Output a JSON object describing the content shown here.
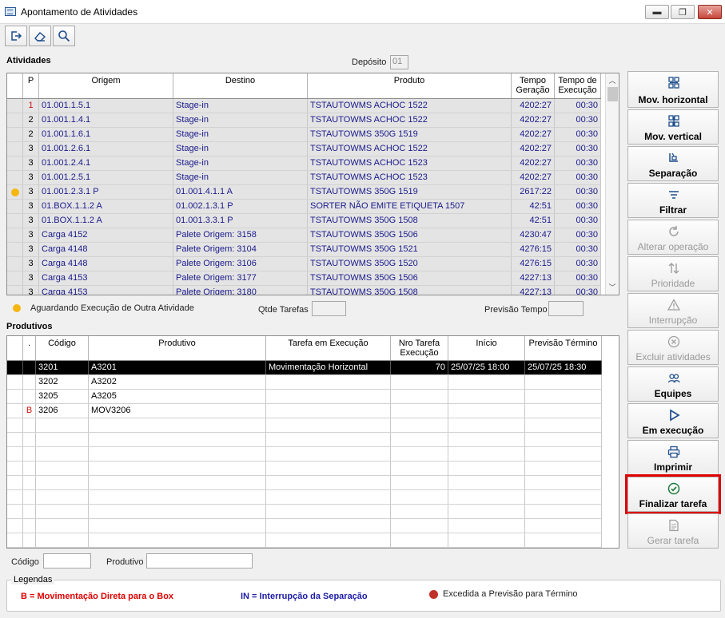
{
  "window": {
    "title": "Apontamento de Atividades",
    "min": "▬",
    "max": "❐",
    "close": "✕"
  },
  "toolbar": {
    "icons": [
      "exit-icon",
      "eraser-icon",
      "search-icon"
    ]
  },
  "atividades": {
    "label": "Atividades",
    "deposito_label": "Depósito",
    "deposito_value": "01",
    "columns": [
      "P",
      "Origem",
      "Destino",
      "Produto",
      "Tempo Geração",
      "Tempo de Execução"
    ],
    "rows": [
      {
        "p": "1",
        "origem": "01.001.1.5.1",
        "destino": "Stage-in",
        "produto": "TSTAUTOWMS ACHOC 1522",
        "geracao": "4202:27",
        "execucao": "00:30",
        "marker": false,
        "p_red": true
      },
      {
        "p": "2",
        "origem": "01.001.1.4.1",
        "destino": "Stage-in",
        "produto": "TSTAUTOWMS ACHOC 1522",
        "geracao": "4202:27",
        "execucao": "00:30",
        "marker": false,
        "p_red": false
      },
      {
        "p": "2",
        "origem": "01.001.1.6.1",
        "destino": "Stage-in",
        "produto": "TSTAUTOWMS 350G 1519",
        "geracao": "4202:27",
        "execucao": "00:30",
        "marker": false,
        "p_red": false
      },
      {
        "p": "3",
        "origem": "01.001.2.6.1",
        "destino": "Stage-in",
        "produto": "TSTAUTOWMS ACHOC 1522",
        "geracao": "4202:27",
        "execucao": "00:30",
        "marker": false,
        "p_red": false
      },
      {
        "p": "3",
        "origem": "01.001.2.4.1",
        "destino": "Stage-in",
        "produto": "TSTAUTOWMS ACHOC 1523",
        "geracao": "4202:27",
        "execucao": "00:30",
        "marker": false,
        "p_red": false
      },
      {
        "p": "3",
        "origem": "01.001.2.5.1",
        "destino": "Stage-in",
        "produto": "TSTAUTOWMS ACHOC 1523",
        "geracao": "4202:27",
        "execucao": "00:30",
        "marker": false,
        "p_red": false
      },
      {
        "p": "3",
        "origem": "01.001.2.3.1 P",
        "destino": "01.001.4.1.1 A",
        "produto": "TSTAUTOWMS 350G 1519",
        "geracao": "2617:22",
        "execucao": "00:30",
        "marker": true,
        "p_red": false
      },
      {
        "p": "3",
        "origem": "01.BOX.1.1.2 A",
        "destino": "01.002.1.3.1 P",
        "produto": "SORTER NÃO EMITE ETIQUETA 1507",
        "geracao": "42:51",
        "execucao": "00:30",
        "marker": false,
        "p_red": false
      },
      {
        "p": "3",
        "origem": "01.BOX.1.1.2 A",
        "destino": "01.001.3.3.1 P",
        "produto": "TSTAUTOWMS 350G 1508",
        "geracao": "42:51",
        "execucao": "00:30",
        "marker": false,
        "p_red": false
      },
      {
        "p": "3",
        "origem": "Carga 4152",
        "destino": "Palete Origem: 3158",
        "produto": "TSTAUTOWMS 350G 1506",
        "geracao": "4230:47",
        "execucao": "00:30",
        "marker": false,
        "p_red": false
      },
      {
        "p": "3",
        "origem": "Carga 4148",
        "destino": "Palete Origem: 3104",
        "produto": "TSTAUTOWMS 350G 1521",
        "geracao": "4276:15",
        "execucao": "00:30",
        "marker": false,
        "p_red": false
      },
      {
        "p": "3",
        "origem": "Carga 4148",
        "destino": "Palete Origem: 3106",
        "produto": "TSTAUTOWMS 350G 1520",
        "geracao": "4276:15",
        "execucao": "00:30",
        "marker": false,
        "p_red": false
      },
      {
        "p": "3",
        "origem": "Carga 4153",
        "destino": "Palete Origem: 3177",
        "produto": "TSTAUTOWMS 350G 1506",
        "geracao": "4227:13",
        "execucao": "00:30",
        "marker": false,
        "p_red": false
      },
      {
        "p": "3",
        "origem": "Carga 4153",
        "destino": "Palete Origem: 3180",
        "produto": "TSTAUTOWMS 350G 1508",
        "geracao": "4227:13",
        "execucao": "00:30",
        "marker": false,
        "p_red": false
      }
    ],
    "marker_legend": "Aguardando Execução de Outra Atividade",
    "qtde_label": "Qtde Tarefas",
    "qtde_value": "",
    "previsao_label": "Previsão Tempo",
    "previsao_value": ""
  },
  "produtos": {
    "label": "Produtivos",
    "columns": [
      ".",
      "Código",
      "Produtivo",
      "Tarefa em Execução",
      "Nro Tarefa Execução",
      "Início",
      "Previsão Término"
    ],
    "rows": [
      {
        "flag": "",
        "codigo": "3201",
        "produtivo": "A3201",
        "tarefa": "Movimentação Horizontal",
        "nro": "70",
        "inicio": "25/07/25  18:00",
        "termino": "25/07/25  18:30",
        "selected": true
      },
      {
        "flag": "",
        "codigo": "3202",
        "produtivo": "A3202",
        "tarefa": "",
        "nro": "",
        "inicio": "",
        "termino": "",
        "selected": false
      },
      {
        "flag": "",
        "codigo": "3205",
        "produtivo": "A3205",
        "tarefa": "",
        "nro": "",
        "inicio": "",
        "termino": "",
        "selected": false
      },
      {
        "flag": "B",
        "codigo": "3206",
        "produtivo": "MOV3206",
        "tarefa": "",
        "nro": "",
        "inicio": "",
        "termino": "",
        "selected": false
      }
    ],
    "codigo_filter_label": "Código",
    "codigo_filter_value": "",
    "produtivo_filter_label": "Produtivo",
    "produtivo_filter_value": ""
  },
  "side_buttons": [
    {
      "label": "Mov. horizontal",
      "icon": "horizontal-move-icon",
      "enabled": true,
      "highlight": false
    },
    {
      "label": "Mov. vertical",
      "icon": "vertical-move-icon",
      "enabled": true,
      "highlight": false
    },
    {
      "label": "Separação",
      "icon": "picking-icon",
      "enabled": true,
      "highlight": false
    },
    {
      "label": "Filtrar",
      "icon": "filter-icon",
      "enabled": true,
      "highlight": false
    },
    {
      "label": "Alterar operação",
      "icon": "refresh-icon",
      "enabled": false,
      "highlight": false
    },
    {
      "label": "Prioridade",
      "icon": "sort-arrows-icon",
      "enabled": false,
      "highlight": false
    },
    {
      "label": "Interrupção",
      "icon": "warning-icon",
      "enabled": false,
      "highlight": false
    },
    {
      "label": "Excluir atividades",
      "icon": "delete-icon",
      "enabled": false,
      "highlight": false
    },
    {
      "label": "Equipes",
      "icon": "team-icon",
      "enabled": true,
      "highlight": false
    },
    {
      "label": "Em execução",
      "icon": "play-icon",
      "enabled": true,
      "highlight": false
    },
    {
      "label": "Imprimir",
      "icon": "printer-icon",
      "enabled": true,
      "highlight": false
    },
    {
      "label": "Finalizar tarefa",
      "icon": "check-circle-icon",
      "enabled": true,
      "highlight": true
    },
    {
      "label": "Gerar tarefa",
      "icon": "document-icon",
      "enabled": false,
      "highlight": false
    }
  ],
  "legends": {
    "title": "Legendas",
    "b": "B = Movimentação Direta para o Box",
    "in": "IN = Interrupção da Separação",
    "excedida": "Excedida a Previsão para Término"
  },
  "colors": {
    "red": "#e00000",
    "blue": "#1c1ca8",
    "marker": "#f5b70f",
    "highlight": "#e00000"
  }
}
